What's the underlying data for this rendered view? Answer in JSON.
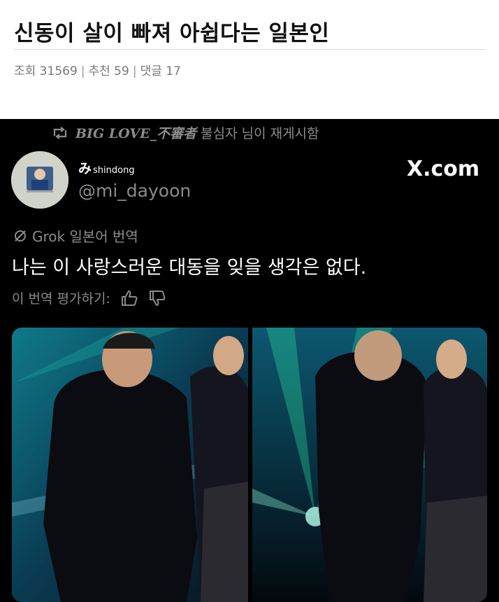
{
  "post": {
    "title": "신동이 살이 빠져 아쉽다는 일본인",
    "meta_views": "조회 31569",
    "meta_recs": "추천 59",
    "meta_comments": "댓글 17",
    "meta_sep": "|"
  },
  "tweet": {
    "repost_user": "BIG LOVE_不審者",
    "repost_text": "불심자 님이 재게시함",
    "display_name": "み",
    "display_name_small": "shindong",
    "handle": "@mi_dayoon",
    "platform_logo": "X.com",
    "grok_label": "Grok 일본어 번역",
    "translation": "나는 이 사랑스러운 대동을 잊을 생각은 없다.",
    "rate_label": "이 번역 평가하기:"
  },
  "icons": {
    "repost": "repost-icon",
    "grok": "grok-icon",
    "thumbs_up": "thumbs-up-icon",
    "thumbs_down": "thumbs-down-icon"
  },
  "colors": {
    "tweet_bg": "#000000",
    "muted": "#8b8b8b",
    "stage_green": "#2fe0a0"
  }
}
